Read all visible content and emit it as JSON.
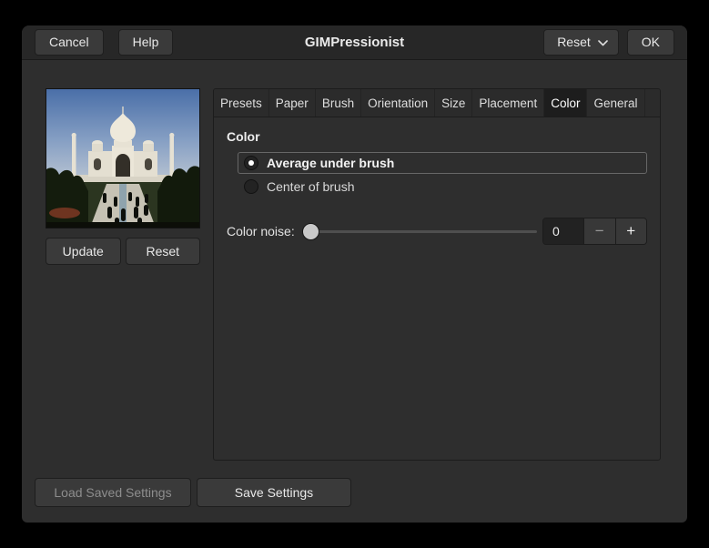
{
  "header": {
    "cancel": "Cancel",
    "help": "Help",
    "title": "GIMPressionist",
    "reset": "Reset",
    "ok": "OK"
  },
  "preview": {
    "image": "taj-mahal-photo-preview",
    "update": "Update",
    "reset": "Reset"
  },
  "tabs": {
    "items": [
      "Presets",
      "Paper",
      "Brush",
      "Orientation",
      "Size",
      "Placement",
      "Color",
      "General"
    ],
    "active": "Color"
  },
  "color_tab": {
    "heading": "Color",
    "options": [
      {
        "label": "Average under brush",
        "selected": true
      },
      {
        "label": "Center of brush",
        "selected": false
      }
    ],
    "noise": {
      "label": "Color noise:",
      "value": "0",
      "slider_position": 0,
      "decrement": "−",
      "increment": "+"
    }
  },
  "footer": {
    "load": "Load Saved Settings",
    "save": "Save Settings"
  },
  "colors": {
    "window_frame": "#000000",
    "dialog_bg": "#2e2e2e",
    "headerbar_bg": "#272727",
    "button_bg": "#3a3a3a",
    "active_tab_bg": "#1d1d1d",
    "text": "#e8e8e8",
    "disabled_text": "#8d8d8d",
    "entry_bg": "#222222"
  }
}
